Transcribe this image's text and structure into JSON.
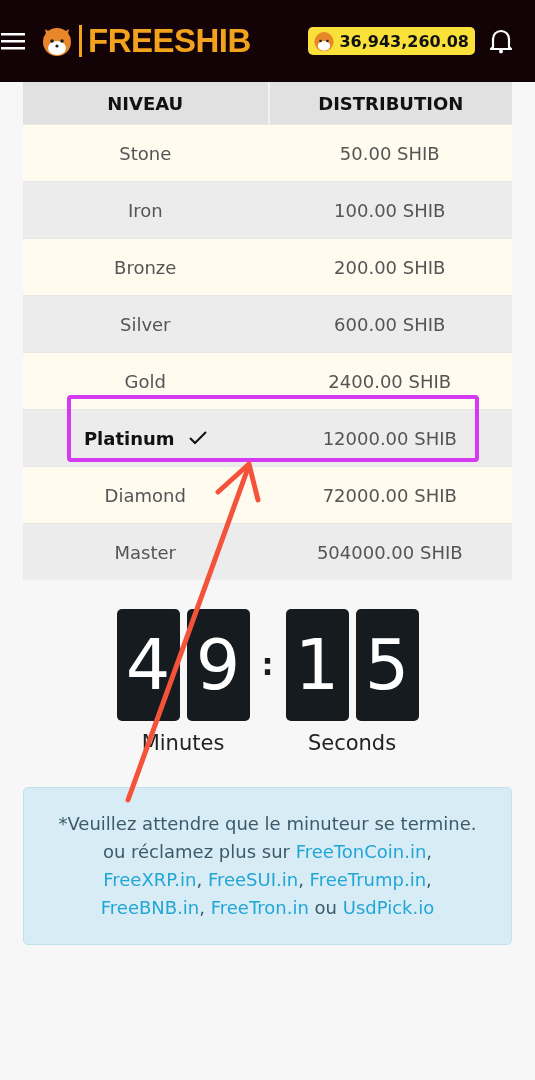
{
  "header": {
    "brand": "FREESHIB",
    "balance": "36,943,260.08"
  },
  "table": {
    "columns": [
      "NIVEAU",
      "DISTRIBUTION"
    ],
    "rows": [
      {
        "level": "Stone",
        "distribution": "50.00 SHIB",
        "selected": false
      },
      {
        "level": "Iron",
        "distribution": "100.00 SHIB",
        "selected": false
      },
      {
        "level": "Bronze",
        "distribution": "200.00 SHIB",
        "selected": false
      },
      {
        "level": "Silver",
        "distribution": "600.00 SHIB",
        "selected": false
      },
      {
        "level": "Gold",
        "distribution": "2400.00 SHIB",
        "selected": false
      },
      {
        "level": "Platinum",
        "distribution": "12000.00 SHIB",
        "selected": true
      },
      {
        "level": "Diamond",
        "distribution": "72000.00 SHIB",
        "selected": false
      },
      {
        "level": "Master",
        "distribution": "504000.00 SHIB",
        "selected": false
      }
    ]
  },
  "timer": {
    "minutes": [
      "4",
      "9"
    ],
    "separator": ":",
    "seconds": [
      "1",
      "5"
    ],
    "minutes_label": "Minutes",
    "seconds_label": "Seconds"
  },
  "notice": {
    "parts": [
      {
        "kind": "text",
        "text": "*Veuillez attendre que le minuteur se termine. ou réclamez plus sur "
      },
      {
        "kind": "link",
        "text": "FreeTonCoin.in"
      },
      {
        "kind": "text",
        "text": ", "
      },
      {
        "kind": "link",
        "text": "FreeXRP.in"
      },
      {
        "kind": "text",
        "text": ", "
      },
      {
        "kind": "link",
        "text": "FreeSUI.in"
      },
      {
        "kind": "text",
        "text": ", "
      },
      {
        "kind": "link",
        "text": "FreeTrump.in"
      },
      {
        "kind": "text",
        "text": ", "
      },
      {
        "kind": "link",
        "text": "FreeBNB.in"
      },
      {
        "kind": "text",
        "text": ", "
      },
      {
        "kind": "link",
        "text": "FreeTron.in"
      },
      {
        "kind": "text",
        "text": " ou "
      },
      {
        "kind": "link",
        "text": "UsdPick.io"
      }
    ]
  }
}
